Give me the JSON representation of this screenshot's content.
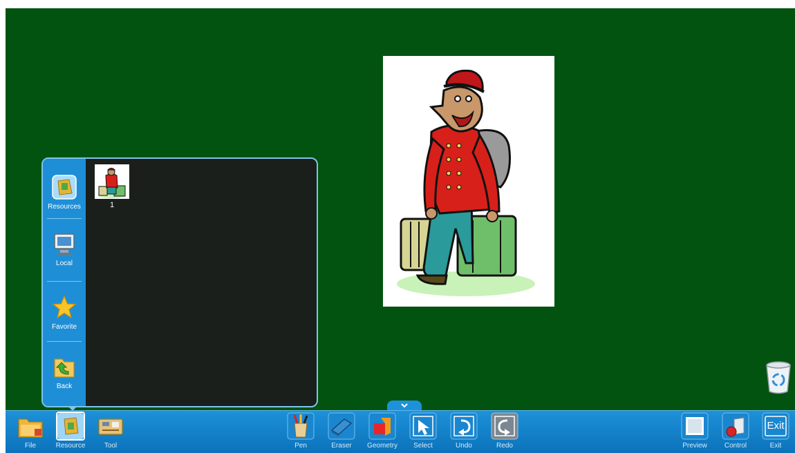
{
  "panel": {
    "sidebar": [
      {
        "label": "Resources",
        "icon": "resources-icon"
      },
      {
        "label": "Local",
        "icon": "computer-icon"
      },
      {
        "label": "Favorite",
        "icon": "star-icon"
      },
      {
        "label": "Back",
        "icon": "back-folder-icon"
      }
    ],
    "thumbnail_label": "1"
  },
  "toolbar": {
    "left": [
      {
        "label": "File",
        "icon": "folder-icon"
      },
      {
        "label": "Resource",
        "icon": "resource-icon",
        "active": true
      },
      {
        "label": "Tool",
        "icon": "toolbox-icon"
      }
    ],
    "center": [
      {
        "label": "Pen",
        "icon": "pen-icon"
      },
      {
        "label": "Eraser",
        "icon": "eraser-icon"
      },
      {
        "label": "Geometry",
        "icon": "geometry-icon"
      },
      {
        "label": "Select",
        "icon": "select-icon"
      },
      {
        "label": "Undo",
        "icon": "undo-icon"
      },
      {
        "label": "Redo",
        "icon": "redo-icon"
      }
    ],
    "right": [
      {
        "label": "Preview",
        "icon": "preview-icon"
      },
      {
        "label": "Control",
        "icon": "control-icon"
      },
      {
        "label": "Exit",
        "icon": "exit-icon"
      }
    ],
    "exit_icon_text": "Exit"
  },
  "colors": {
    "board": "#035310",
    "toolbar": "#1d91d9",
    "panel_bg": "#1a1f1b",
    "panel_sidebar": "#1e8fd6"
  }
}
